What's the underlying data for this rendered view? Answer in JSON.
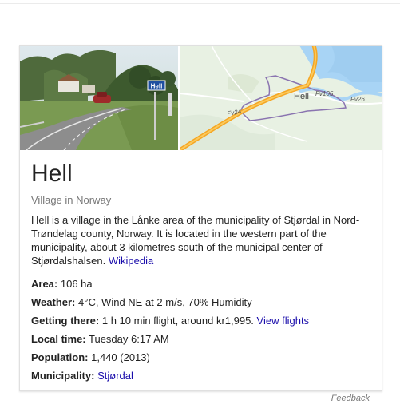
{
  "title": "Hell",
  "subtitle": "Village in Norway",
  "description": {
    "text": "Hell is a village in the Lånke area of the municipality of Stjørdal in Nord-Trøndelag county, Norway. It is located in the western part of the municipality, about 3 kilometres south of the municipal center of Stjørdalshalsen.",
    "source_link": "Wikipedia"
  },
  "photo": {
    "sign_text": "Hell"
  },
  "map": {
    "place_label": "Hell",
    "road_labels": [
      "Fv24",
      "Fv26",
      "Fv105"
    ]
  },
  "facts": {
    "area": {
      "label": "Area:",
      "value": "106 ha"
    },
    "weather": {
      "label": "Weather:",
      "value": "4°C, Wind NE at 2 m/s, 70% Humidity"
    },
    "getting_there": {
      "label": "Getting there:",
      "value": "1 h 10 min flight, around kr1,995.",
      "link": "View flights"
    },
    "local_time": {
      "label": "Local time:",
      "value": "Tuesday 6:17 AM"
    },
    "population": {
      "label": "Population:",
      "value": "1,440 (2013)"
    },
    "municipality": {
      "label": "Municipality:",
      "link": "Stjørdal"
    }
  },
  "feedback_label": "Feedback",
  "colors": {
    "link": "#1a0dab",
    "subtitle": "#777777",
    "map_water": "#a8d4f5",
    "map_land": "#e8f1e3",
    "highway": "#f5a623",
    "boundary": "#8a74b0"
  }
}
